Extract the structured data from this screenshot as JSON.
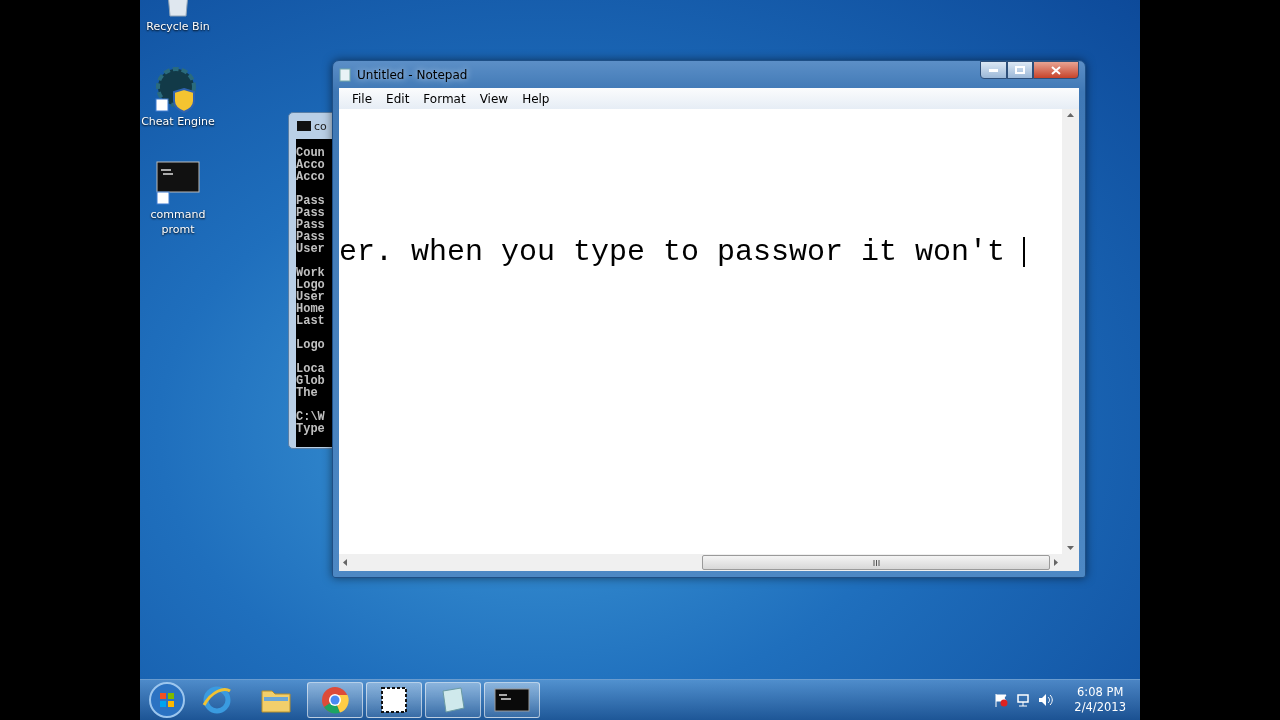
{
  "desktop_icons": [
    {
      "kind": "recycle",
      "label": "Recycle Bin"
    },
    {
      "kind": "engine",
      "label": "Cheat Engine"
    },
    {
      "kind": "console",
      "label": "command promt"
    }
  ],
  "console_window": {
    "title": "co",
    "blocks": [
      {
        "lines": [
          "Coun",
          "Acco",
          "Acco"
        ]
      },
      {
        "lines": [
          "Pass",
          "Pass",
          "Pass",
          "Pass",
          "User"
        ]
      },
      {
        "lines": [
          "Work",
          "Logo",
          "User",
          "Home",
          "Last"
        ]
      },
      {
        "lines": [
          "Logo"
        ]
      },
      {
        "lines": [
          "Loca",
          "Glob",
          "The"
        ]
      },
      {
        "lines": [
          "C:\\W",
          "Type"
        ]
      }
    ]
  },
  "notepad": {
    "title": "Untitled - Notepad",
    "menu": [
      "File",
      "Edit",
      "Format",
      "View",
      "Help"
    ],
    "text": "er. when you type to passwor it won't"
  },
  "taskbar": {
    "items": [
      {
        "kind": "browser",
        "active": false
      },
      {
        "kind": "folder",
        "active": false
      },
      {
        "kind": "chrome",
        "active": true
      },
      {
        "kind": "snip",
        "active": true
      },
      {
        "kind": "notepad",
        "active": true
      },
      {
        "kind": "console",
        "active": true
      }
    ],
    "clock": {
      "time": "6:08 PM",
      "date": "2/4/2013"
    }
  }
}
